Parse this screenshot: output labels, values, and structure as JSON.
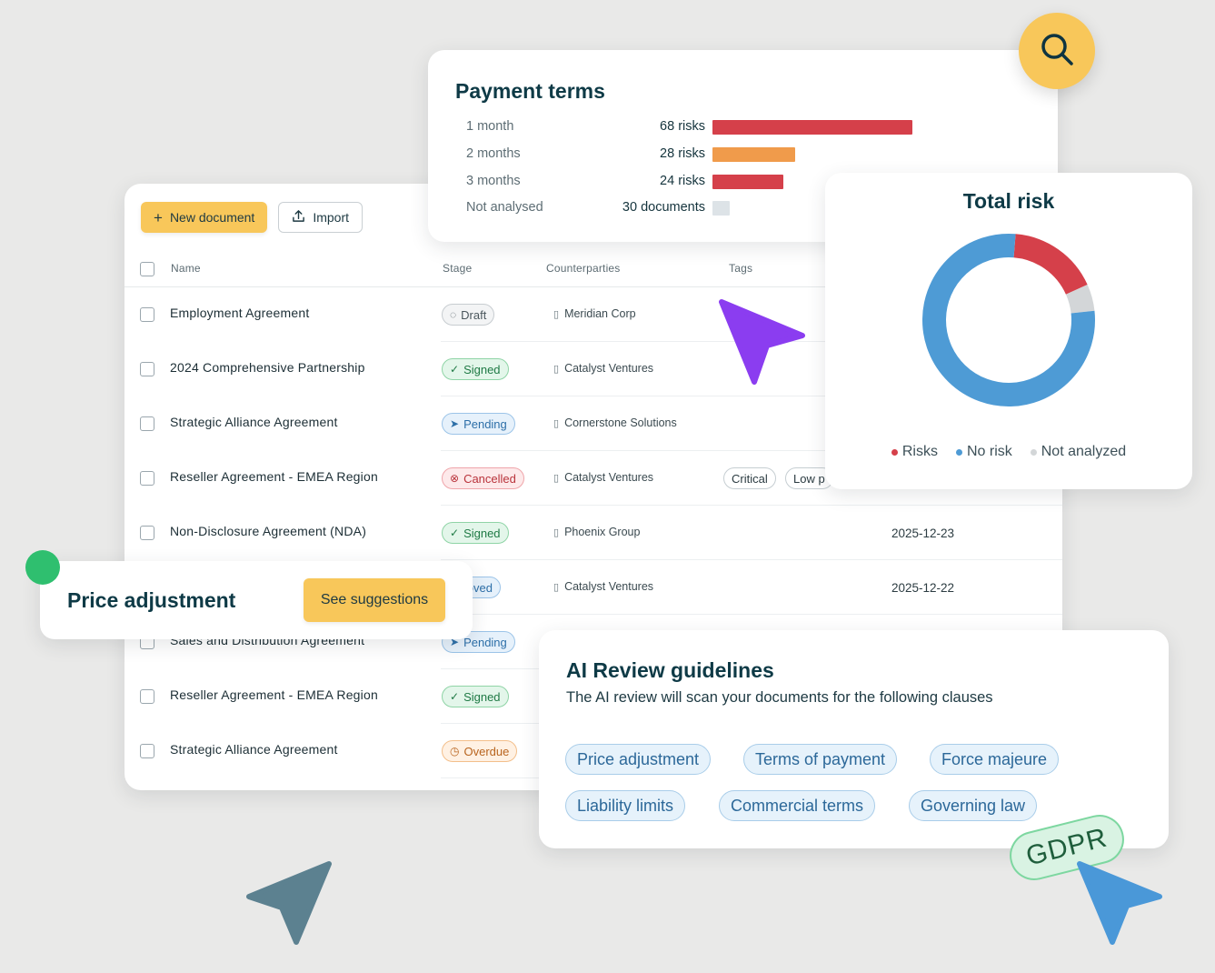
{
  "toolbar": {
    "new_document": "New document",
    "import": "Import"
  },
  "table": {
    "headers": {
      "name": "Name",
      "stage": "Stage",
      "counterparties": "Counterparties",
      "tags": "Tags"
    },
    "rows": [
      {
        "name": "Employment Agreement",
        "stage": "Draft",
        "counterparty": "Meridian Corp"
      },
      {
        "name": "2024 Comprehensive Partnership",
        "stage": "Signed",
        "counterparty": "Catalyst Ventures"
      },
      {
        "name": "Strategic Alliance Agreement",
        "stage": "Pending",
        "counterparty": "Cornerstone Solutions"
      },
      {
        "name": "Reseller Agreement - EMEA Region",
        "stage": "Cancelled",
        "counterparty": "Catalyst Ventures",
        "tags": [
          "Critical",
          "Low p"
        ]
      },
      {
        "name": "Non-Disclosure Agreement (NDA)",
        "stage": "Signed",
        "counterparty": "Phoenix Group",
        "date": "2025-12-23"
      },
      {
        "name": "",
        "stage": "pproved",
        "counterparty": "Catalyst Ventures",
        "date": "2025-12-22"
      },
      {
        "name": "Sales and Distribution Agreement",
        "stage": "Pending",
        "counterparty": ""
      },
      {
        "name": "Reseller Agreement - EMEA Region",
        "stage": "Signed",
        "counterparty": ""
      },
      {
        "name": "Strategic Alliance Agreement",
        "stage": "Overdue",
        "counterparty": ""
      }
    ]
  },
  "payment_terms": {
    "title": "Payment terms",
    "rows": [
      {
        "label": "1 month",
        "value": "68 risks",
        "count": 68,
        "color": "#d5404a"
      },
      {
        "label": "2 months",
        "value": "28 risks",
        "count": 28,
        "color": "#f09b4b"
      },
      {
        "label": "3 months",
        "value": "24 risks",
        "count": 24,
        "color": "#d5404a"
      },
      {
        "label": "Not analysed",
        "value": "30 documents",
        "count": 30,
        "color": "#dde3e7"
      }
    ]
  },
  "total_risk": {
    "title": "Total risk",
    "slices": [
      {
        "name": "Risks",
        "fraction": 0.17,
        "color": "#d5404a"
      },
      {
        "name": "Not analyzed",
        "fraction": 0.05,
        "color": "#d3d6d8"
      },
      {
        "name": "No risk",
        "fraction": 0.78,
        "color": "#4e9bd5"
      }
    ],
    "legend": [
      {
        "label": "Risks",
        "color": "#d5404a"
      },
      {
        "label": "No risk",
        "color": "#4e9bd5"
      },
      {
        "label": "Not analyzed",
        "color": "#d3d6d8"
      }
    ]
  },
  "price_adjustment": {
    "title": "Price adjustment",
    "button": "See suggestions"
  },
  "ai_review": {
    "title": "AI Review guidelines",
    "subtitle": "The AI review will scan your documents for the following clauses",
    "clauses": [
      "Price adjustment",
      "Terms of payment",
      "Force majeure",
      "Liability limits",
      "Commercial terms",
      "Governing law"
    ]
  },
  "gdpr_tag": "GDPR",
  "icons": {
    "search": "search-icon",
    "plus": "plus-icon",
    "upload": "upload-icon",
    "building": "building-icon",
    "cursor": "cursor-arrow-icon"
  }
}
